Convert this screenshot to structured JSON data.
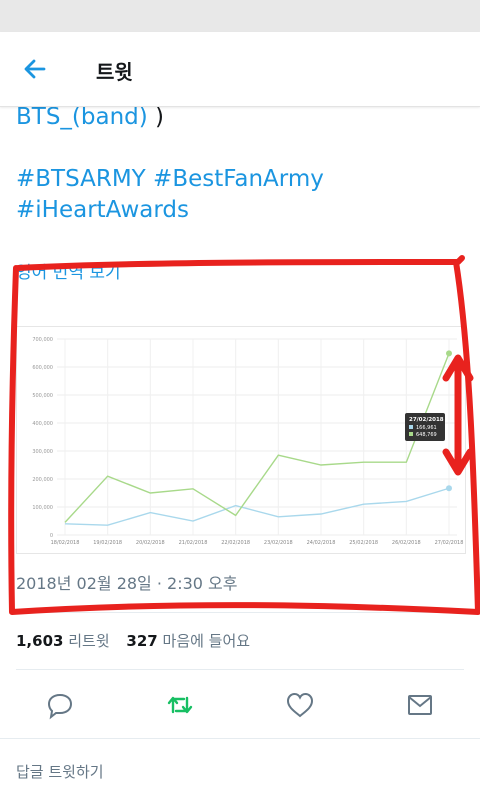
{
  "header": {
    "title": "트윗"
  },
  "tweet": {
    "line1_link": "BTS_(band)",
    "line1_rest": " )",
    "hashtags_line1": [
      "#BTSARMY",
      "#BestFanArmy"
    ],
    "hashtags_line2": [
      "#iHeartAwards"
    ]
  },
  "translate_label": "영어 번역 보기",
  "chart_data": {
    "type": "line",
    "categories": [
      "18/02/2018",
      "19/02/2018",
      "20/02/2018",
      "21/02/2018",
      "22/02/2018",
      "23/02/2018",
      "24/02/2018",
      "25/02/2018",
      "26/02/2018",
      "27/02/2018"
    ],
    "ylim": [
      0,
      700000
    ],
    "yticks": [
      "700,000",
      "600,000",
      "500,000",
      "400,000",
      "300,000",
      "200,000",
      "100,000",
      "0"
    ],
    "grid": true,
    "series": [
      {
        "color": "#a9d8ec",
        "values": [
          40000,
          35000,
          80000,
          50000,
          105000,
          65000,
          75000,
          110000,
          120000,
          166961
        ]
      },
      {
        "color": "#a8d98a",
        "values": [
          45000,
          210000,
          150000,
          165000,
          70000,
          285000,
          250000,
          260000,
          260000,
          648769
        ]
      }
    ],
    "tooltip": {
      "date": "27/02/2018",
      "values": [
        "166,961",
        "648,769"
      ]
    }
  },
  "timestamp": "2018년 02월 28일 · 2:30 오후",
  "stats": {
    "retweets_count": "1,603",
    "retweets_label": "리트윗",
    "likes_count": "327",
    "likes_label": "마음에 들어요"
  },
  "actions": {
    "retweet_color": "#17bf63",
    "icon_color": "#657786"
  },
  "reply_placeholder": "답글 트윗하기",
  "colors": {
    "accent": "#1b95e0",
    "annotation": "#e8221e"
  }
}
